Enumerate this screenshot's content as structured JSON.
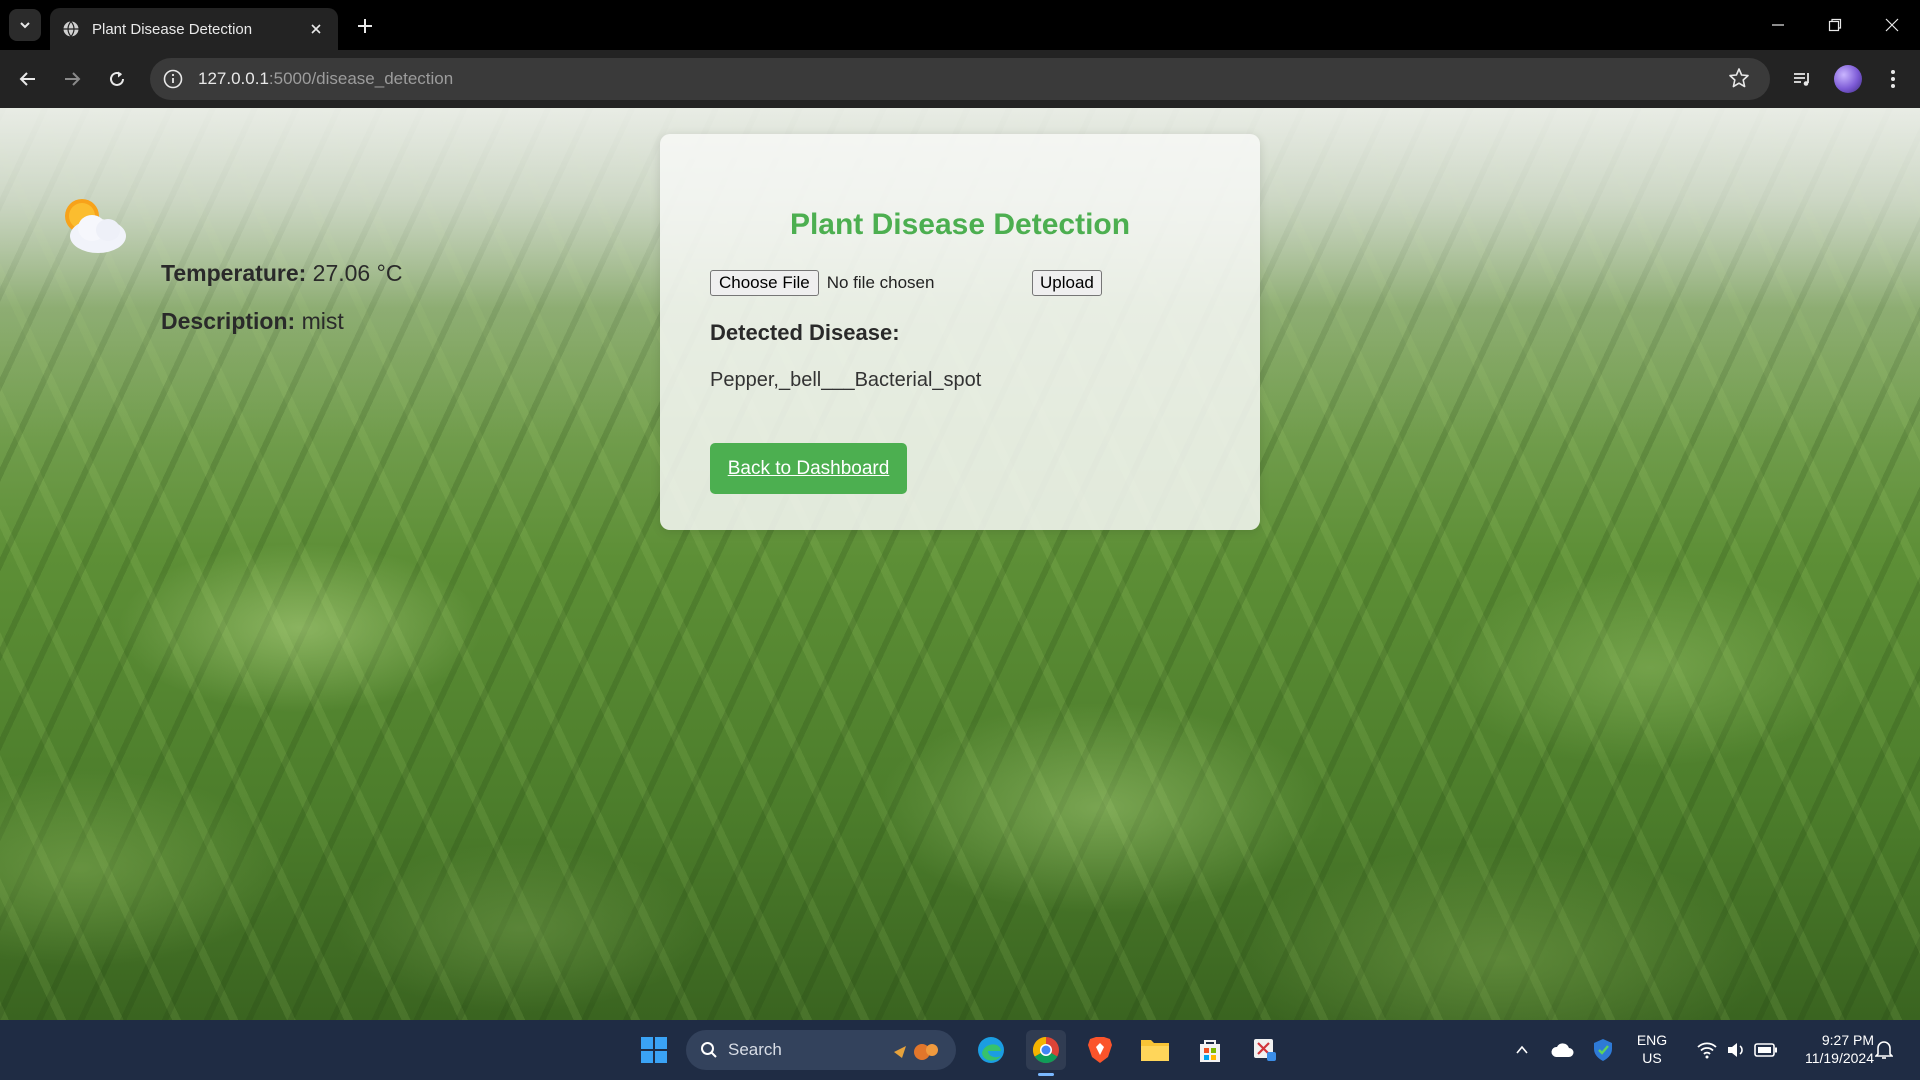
{
  "browser": {
    "tab_title": "Plant Disease Detection",
    "url_host": "127.0.0.1",
    "url_path": ":5000/disease_detection"
  },
  "weather": {
    "temperature_label": "Temperature:",
    "temperature_value": " 27.06 °C",
    "description_label": "Description:",
    "description_value": " mist"
  },
  "card": {
    "title": "Plant Disease Detection",
    "choose_file_label": "Choose File",
    "no_file_text": "No file chosen",
    "upload_label": "Upload",
    "detected_label": "Detected Disease:",
    "detected_value": "Pepper,_bell___Bacterial_spot",
    "back_label": "Back to Dashboard"
  },
  "taskbar": {
    "search_label": "Search",
    "lang_line1": "ENG",
    "lang_line2": "US",
    "time": "9:27 PM",
    "date": "11/19/2024"
  },
  "colors": {
    "accent_green": "#4caf50",
    "taskbar_bg": "#1f2c44",
    "chrome_bg": "#232323"
  }
}
